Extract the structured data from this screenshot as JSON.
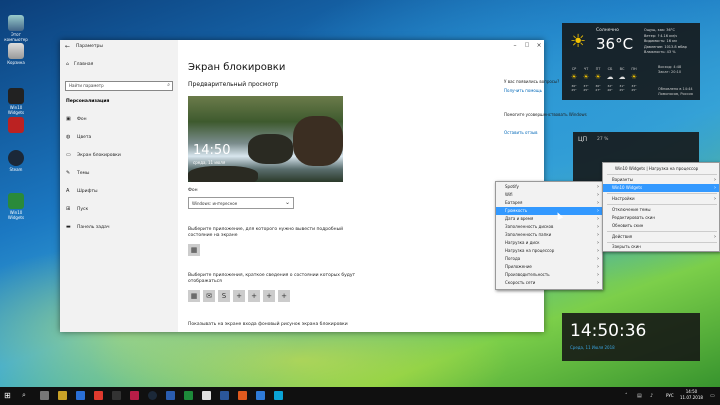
{
  "desktop": {
    "icons": [
      {
        "label": "Этот компьютер"
      },
      {
        "label": "Корзина"
      },
      {
        "label": "Win10 Widgets"
      },
      {
        "label": "Steam"
      },
      {
        "label": "Win10 Widgets"
      }
    ]
  },
  "settings": {
    "title": "Параметры",
    "home": "Главная",
    "search_placeholder": "Найти параметр",
    "section": "Персонализация",
    "nav": [
      {
        "icon": "image-icon",
        "label": "Фон"
      },
      {
        "icon": "palette-icon",
        "label": "Цвета"
      },
      {
        "icon": "monitor-icon",
        "label": "Экран блокировки"
      },
      {
        "icon": "brush-icon",
        "label": "Темы"
      },
      {
        "icon": "font-icon",
        "label": "Шрифты"
      },
      {
        "icon": "start-icon",
        "label": "Пуск"
      },
      {
        "icon": "taskbar-icon",
        "label": "Панель задач"
      }
    ],
    "heading": "Экран блокировки",
    "preview_heading": "Предварительный просмотр",
    "preview_time": "14:50",
    "preview_date": "среда, 11 июля",
    "bg_label": "Фон",
    "bg_value": "Windows: интересное",
    "detail_label": "Выберите приложение, для которого нужно вывести подробный состояние на экране",
    "quick_label": "Выберите приложения, краткое сведения о состоянии которых будут отображаться",
    "bottom_label": "Показывать на экране входа фоновый рисунок экрана блокировки",
    "question": "У вас появились вопросы?",
    "get_help": "Получить помощь",
    "improve": "Помогите усовершенствовать Windows",
    "feedback": "Оставить отзыв"
  },
  "weather": {
    "city": "Солнечно",
    "temp": "36°C",
    "details": [
      "Ощущ. как: 36°C",
      "Ветер: ↑4.16 км/ч",
      "Видимость: 16 км",
      "Давление: 1013.8 мбар",
      "Влажность: 43 %"
    ],
    "days": [
      "СР",
      "ЧТ",
      "ПТ",
      "СБ",
      "ВС",
      "ПН"
    ],
    "day_icons": [
      "☀",
      "☀",
      "☀",
      "☁",
      "☁",
      "☀"
    ],
    "highs": [
      "36°",
      "37°",
      "36°",
      "32°",
      "31°",
      "33°"
    ],
    "lows": [
      "25°",
      "25°",
      "27°",
      "26°",
      "25°",
      "25°"
    ],
    "sunrise_label": "Восход:",
    "sunrise": "4:48",
    "sunset_label": "Закат:",
    "sunset": "20:10",
    "updated": "Обновлено в 14:44",
    "location": "Ломоносов, Россия"
  },
  "cpu": {
    "title": "ЦП",
    "percent": "27 %"
  },
  "clock": {
    "time": "14:50:36",
    "date": "Среда, 11 Июля 2018"
  },
  "menu1": {
    "items": [
      "Spotify",
      "Wifi",
      "Батарея",
      "Громкость",
      "Дата и время",
      "Заполненность дисков",
      "Заполненность папки",
      "Нагрузка и диск",
      "Нагрузка на процессор",
      "Погода",
      "Приложение",
      "Производительность",
      "Скорость сети"
    ],
    "highlight_index": 3
  },
  "menu2": {
    "header": "Win10 Widgets | Нагрузка на процессор",
    "items": [
      "Варианты",
      "Win10 Widgets",
      "Настройки",
      "Отключение темы",
      "Редактировать скин",
      "Обновить скин",
      "Действия",
      "Закрыть скин"
    ]
  },
  "taskbar": {
    "lang": "РУС",
    "time": "14:50",
    "date": "11.07.2018"
  }
}
